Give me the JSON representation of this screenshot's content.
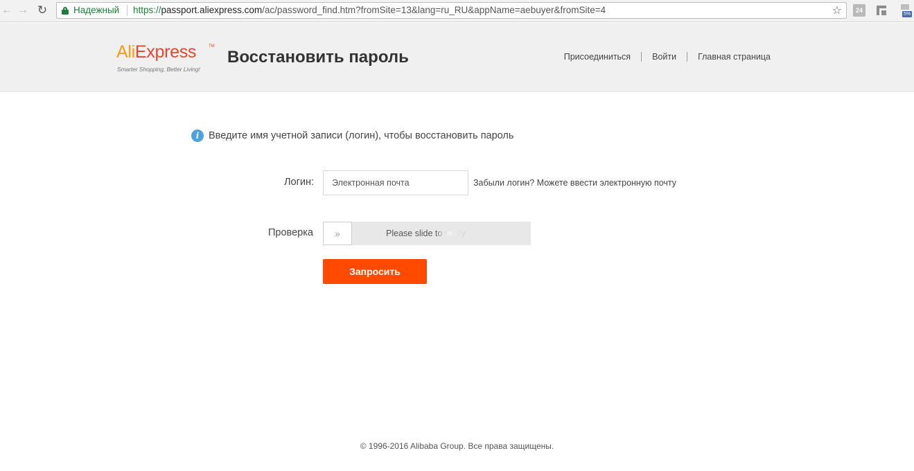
{
  "browser": {
    "secure_label": "Надежный",
    "url_scheme": "https://",
    "url_host": "passport.aliexpress.com",
    "url_path": "/ac/password_find.htm?fromSite=13&lang=ru_RU&appName=aebuyer&fromSite=4",
    "ext_badge_1": "24",
    "ext_badge_3": "5%"
  },
  "header": {
    "logo_ali": "Ali",
    "logo_express": "Express",
    "logo_tm": "TM",
    "logo_tagline": "Smarter Shopping, Better Living!",
    "title": "Восстановить пароль",
    "nav": {
      "join": "Присоединиться",
      "login": "Войти",
      "home": "Главная страница"
    }
  },
  "form": {
    "info_text": "Введите имя учетной записи (логин), чтобы восстановить пароль",
    "login_label": "Логин:",
    "login_placeholder": "Электронная почта",
    "forgot_hint": "Забыли логин? Можете ввести электронную почту",
    "verify_label": "Проверка",
    "slider_text": "Please slide to verify",
    "submit_label": "Запросить"
  },
  "footer": {
    "copyright": "© 1996-2016 Alibaba Group. Все права защищены."
  },
  "colors": {
    "accent": "#ff4a00",
    "secure_green": "#188038",
    "info_blue": "#4fa3dc"
  }
}
